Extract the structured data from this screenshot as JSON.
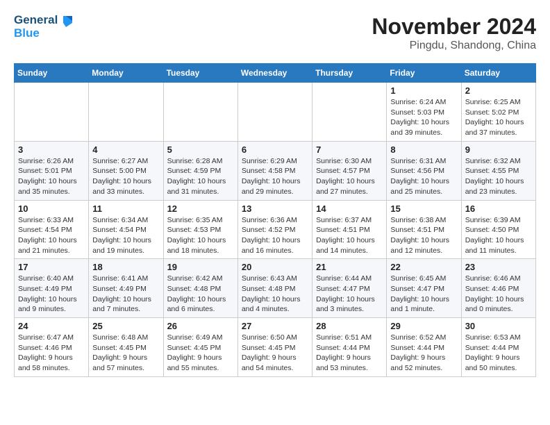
{
  "header": {
    "logo_line1": "General",
    "logo_line2": "Blue",
    "month_title": "November 2024",
    "location": "Pingdu, Shandong, China"
  },
  "weekdays": [
    "Sunday",
    "Monday",
    "Tuesday",
    "Wednesday",
    "Thursday",
    "Friday",
    "Saturday"
  ],
  "weeks": [
    [
      {
        "day": "",
        "content": ""
      },
      {
        "day": "",
        "content": ""
      },
      {
        "day": "",
        "content": ""
      },
      {
        "day": "",
        "content": ""
      },
      {
        "day": "",
        "content": ""
      },
      {
        "day": "1",
        "content": "Sunrise: 6:24 AM\nSunset: 5:03 PM\nDaylight: 10 hours\nand 39 minutes."
      },
      {
        "day": "2",
        "content": "Sunrise: 6:25 AM\nSunset: 5:02 PM\nDaylight: 10 hours\nand 37 minutes."
      }
    ],
    [
      {
        "day": "3",
        "content": "Sunrise: 6:26 AM\nSunset: 5:01 PM\nDaylight: 10 hours\nand 35 minutes."
      },
      {
        "day": "4",
        "content": "Sunrise: 6:27 AM\nSunset: 5:00 PM\nDaylight: 10 hours\nand 33 minutes."
      },
      {
        "day": "5",
        "content": "Sunrise: 6:28 AM\nSunset: 4:59 PM\nDaylight: 10 hours\nand 31 minutes."
      },
      {
        "day": "6",
        "content": "Sunrise: 6:29 AM\nSunset: 4:58 PM\nDaylight: 10 hours\nand 29 minutes."
      },
      {
        "day": "7",
        "content": "Sunrise: 6:30 AM\nSunset: 4:57 PM\nDaylight: 10 hours\nand 27 minutes."
      },
      {
        "day": "8",
        "content": "Sunrise: 6:31 AM\nSunset: 4:56 PM\nDaylight: 10 hours\nand 25 minutes."
      },
      {
        "day": "9",
        "content": "Sunrise: 6:32 AM\nSunset: 4:55 PM\nDaylight: 10 hours\nand 23 minutes."
      }
    ],
    [
      {
        "day": "10",
        "content": "Sunrise: 6:33 AM\nSunset: 4:54 PM\nDaylight: 10 hours\nand 21 minutes."
      },
      {
        "day": "11",
        "content": "Sunrise: 6:34 AM\nSunset: 4:54 PM\nDaylight: 10 hours\nand 19 minutes."
      },
      {
        "day": "12",
        "content": "Sunrise: 6:35 AM\nSunset: 4:53 PM\nDaylight: 10 hours\nand 18 minutes."
      },
      {
        "day": "13",
        "content": "Sunrise: 6:36 AM\nSunset: 4:52 PM\nDaylight: 10 hours\nand 16 minutes."
      },
      {
        "day": "14",
        "content": "Sunrise: 6:37 AM\nSunset: 4:51 PM\nDaylight: 10 hours\nand 14 minutes."
      },
      {
        "day": "15",
        "content": "Sunrise: 6:38 AM\nSunset: 4:51 PM\nDaylight: 10 hours\nand 12 minutes."
      },
      {
        "day": "16",
        "content": "Sunrise: 6:39 AM\nSunset: 4:50 PM\nDaylight: 10 hours\nand 11 minutes."
      }
    ],
    [
      {
        "day": "17",
        "content": "Sunrise: 6:40 AM\nSunset: 4:49 PM\nDaylight: 10 hours\nand 9 minutes."
      },
      {
        "day": "18",
        "content": "Sunrise: 6:41 AM\nSunset: 4:49 PM\nDaylight: 10 hours\nand 7 minutes."
      },
      {
        "day": "19",
        "content": "Sunrise: 6:42 AM\nSunset: 4:48 PM\nDaylight: 10 hours\nand 6 minutes."
      },
      {
        "day": "20",
        "content": "Sunrise: 6:43 AM\nSunset: 4:48 PM\nDaylight: 10 hours\nand 4 minutes."
      },
      {
        "day": "21",
        "content": "Sunrise: 6:44 AM\nSunset: 4:47 PM\nDaylight: 10 hours\nand 3 minutes."
      },
      {
        "day": "22",
        "content": "Sunrise: 6:45 AM\nSunset: 4:47 PM\nDaylight: 10 hours\nand 1 minute."
      },
      {
        "day": "23",
        "content": "Sunrise: 6:46 AM\nSunset: 4:46 PM\nDaylight: 10 hours\nand 0 minutes."
      }
    ],
    [
      {
        "day": "24",
        "content": "Sunrise: 6:47 AM\nSunset: 4:46 PM\nDaylight: 9 hours\nand 58 minutes."
      },
      {
        "day": "25",
        "content": "Sunrise: 6:48 AM\nSunset: 4:45 PM\nDaylight: 9 hours\nand 57 minutes."
      },
      {
        "day": "26",
        "content": "Sunrise: 6:49 AM\nSunset: 4:45 PM\nDaylight: 9 hours\nand 55 minutes."
      },
      {
        "day": "27",
        "content": "Sunrise: 6:50 AM\nSunset: 4:45 PM\nDaylight: 9 hours\nand 54 minutes."
      },
      {
        "day": "28",
        "content": "Sunrise: 6:51 AM\nSunset: 4:44 PM\nDaylight: 9 hours\nand 53 minutes."
      },
      {
        "day": "29",
        "content": "Sunrise: 6:52 AM\nSunset: 4:44 PM\nDaylight: 9 hours\nand 52 minutes."
      },
      {
        "day": "30",
        "content": "Sunrise: 6:53 AM\nSunset: 4:44 PM\nDaylight: 9 hours\nand 50 minutes."
      }
    ]
  ]
}
